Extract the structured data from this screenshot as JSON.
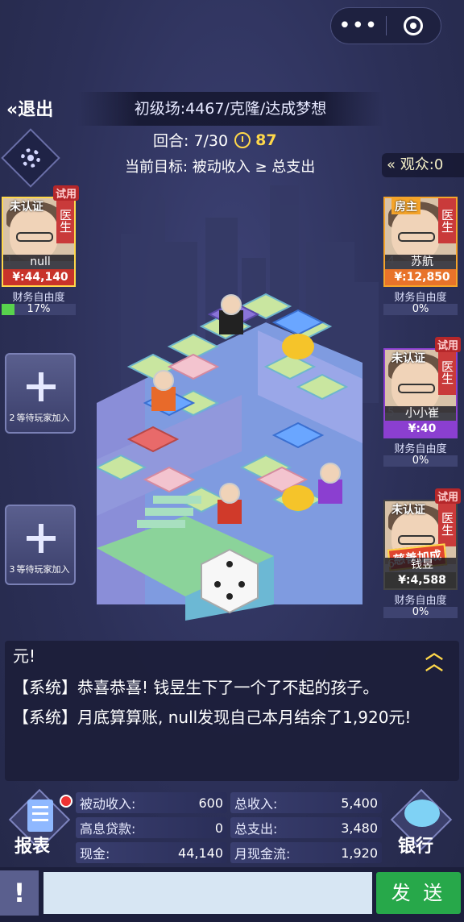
{
  "header": {
    "exit_label": "退出",
    "room_title": "初级场:4467/克隆/达成梦想",
    "round_label": "回合: 7/30",
    "timer": "87",
    "goal": "当前目标: 被动收入 ≥ 总支出",
    "audience": "观众:0"
  },
  "players": [
    {
      "seat": "1",
      "tag": "未认证",
      "trial": "试用",
      "role": "医生",
      "name": "null",
      "money": "¥:44,140",
      "fin_label": "财务自由度",
      "fin_pct": "17%",
      "fin_value": 0.17,
      "money_color": "#c8332a"
    },
    {
      "seat": "4",
      "tag": "房主",
      "role": "医生",
      "name": "苏航",
      "money": "¥:12,850",
      "fin_label": "财务自由度",
      "fin_pct": "0%",
      "fin_value": 0,
      "money_color": "#e8732a"
    },
    {
      "seat": "5",
      "tag": "未认证",
      "trial": "试用",
      "role": "医生",
      "name": "小小崔",
      "money": "¥:40",
      "fin_label": "财务自由度",
      "fin_pct": "0%",
      "fin_value": 0,
      "money_color": "#8b3fd0"
    },
    {
      "seat": "6",
      "tag": "未认证",
      "trial": "试用",
      "role": "医生",
      "name": "钱昱",
      "money": "¥:4,588",
      "fin_label": "财务自由度",
      "fin_pct": "0%",
      "fin_value": 0,
      "badge": "慈善加成",
      "money_color": "#333"
    }
  ],
  "empty_seats": [
    {
      "seat": "2",
      "label": "等待玩家加入"
    },
    {
      "seat": "3",
      "label": "等待玩家加入"
    }
  ],
  "chat": {
    "first": "元!",
    "messages": [
      "【系统】恭喜恭喜! 钱昱生下了一个了不起的孩子。",
      "【系统】月底算算账, null发现自己本月结余了1,920元!"
    ]
  },
  "stats": {
    "passive_income_label": "被动收入:",
    "passive_income": "600",
    "total_income_label": "总收入:",
    "total_income": "5,400",
    "loan_label": "高息贷款:",
    "loan": "0",
    "total_expense_label": "总支出:",
    "total_expense": "3,480",
    "cash_label": "现金:",
    "cash": "44,140",
    "cashflow_label": "月现金流:",
    "cashflow": "1,920"
  },
  "buttons": {
    "report": "报表",
    "bank": "银行",
    "send": "发 送"
  },
  "colors": {
    "accent_gold": "#ffd84a",
    "send_green": "#27a84a",
    "host_orange": "#f5a42a"
  }
}
